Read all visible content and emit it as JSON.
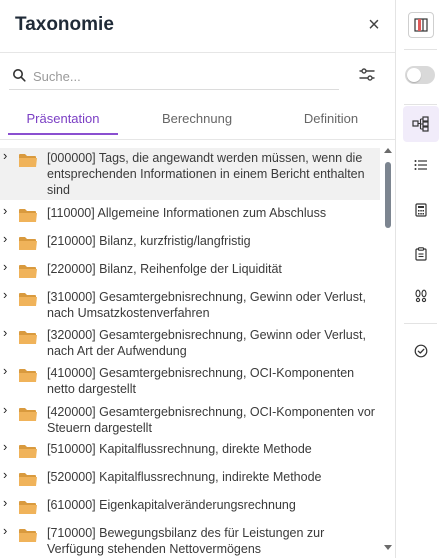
{
  "header": {
    "title": "Taxonomie",
    "close_symbol": "×"
  },
  "search": {
    "placeholder": "Suche...",
    "value": ""
  },
  "tabs": [
    {
      "label": "Präsentation",
      "active": true
    },
    {
      "label": "Berechnung",
      "active": false
    },
    {
      "label": "Definition",
      "active": false
    }
  ],
  "tree": {
    "chevron": "›",
    "items": [
      {
        "label": "[000000] Tags, die angewandt werden müssen, wenn die entsprechenden Informationen in einem Bericht enthalten sind",
        "selected": true
      },
      {
        "label": "[110000] Allgemeine Informationen zum Abschluss",
        "selected": false
      },
      {
        "label": "[210000] Bilanz, kurzfristig/langfristig",
        "selected": false
      },
      {
        "label": "[220000] Bilanz, Reihenfolge der Liquidität",
        "selected": false
      },
      {
        "label": "[310000] Gesamtergebnisrechnung, Gewinn oder Verlust, nach Umsatzkostenverfahren",
        "selected": false
      },
      {
        "label": "[320000] Gesamtergebnisrechnung, Gewinn oder Verlust, nach Art der Aufwendung",
        "selected": false
      },
      {
        "label": "[410000] Gesamtergebnisrechnung, OCI-Komponenten netto dargestellt",
        "selected": false
      },
      {
        "label": "[420000] Gesamtergebnisrechnung, OCI-Komponenten vor Steuern dargestellt",
        "selected": false
      },
      {
        "label": "[510000] Kapitalflussrechnung, direkte Methode",
        "selected": false
      },
      {
        "label": "[520000] Kapitalflussrechnung, indirekte Methode",
        "selected": false
      },
      {
        "label": "[610000] Eigenkapitalveränderungsrechnung",
        "selected": false
      },
      {
        "label": "[710000] Bewegungsbilanz des für Leistungen zur Verfügung stehenden Nettovermögens",
        "selected": false
      }
    ]
  },
  "rail": {
    "icons": [
      "columns-icon",
      "toggle-switch",
      "hierarchy-icon",
      "list-icon",
      "calculator-icon",
      "clipboard-icon",
      "footprints-icon",
      "check-circle-icon"
    ],
    "active": "hierarchy-icon",
    "toggle_on": false
  },
  "colors": {
    "accent": "#8a4fd0",
    "folder": "#f0b35a",
    "scrollbar": "#7c8590"
  }
}
